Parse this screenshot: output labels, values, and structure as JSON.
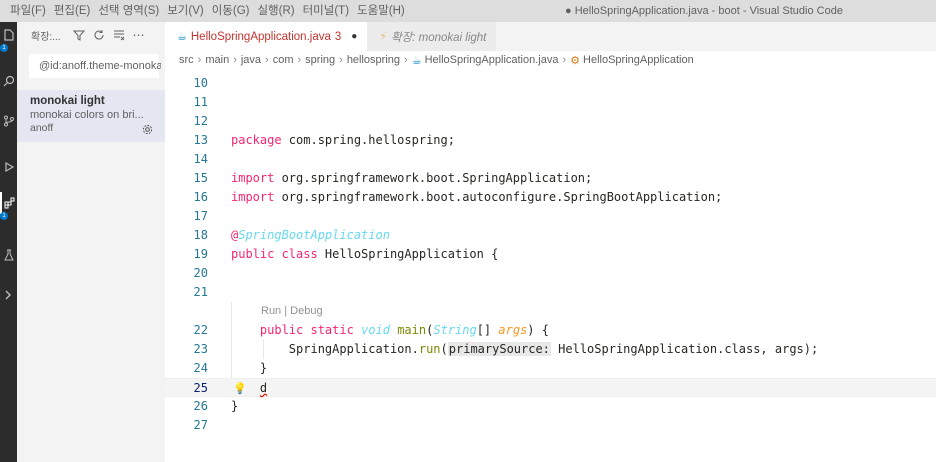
{
  "menu": {
    "items": [
      "파일(F)",
      "편집(E)",
      "선택 영역(S)",
      "보기(V)",
      "이동(G)",
      "실행(R)",
      "터미널(T)",
      "도움말(H)"
    ]
  },
  "window_title": "● HelloSpringApplication.java - boot - Visual Studio Code",
  "activity_bar": {
    "badges": [
      "1",
      "1"
    ]
  },
  "sidebar": {
    "title": "확장:...",
    "search_value": "@id:anoff.theme-monokai-light",
    "extension": {
      "name": "monokai light",
      "description": "monokai colors on bri...",
      "author": "anoff"
    }
  },
  "tabs": [
    {
      "label": "HelloSpringApplication.java",
      "problems": "3",
      "dirty": "●"
    },
    {
      "label": "확장: monokai light"
    }
  ],
  "breadcrumb": [
    "src",
    "main",
    "java",
    "com",
    "spring",
    "hellospring",
    "HelloSpringApplication.java",
    "HelloSpringApplication"
  ],
  "code": {
    "line_numbers": [
      "10",
      "11",
      "12",
      "13",
      "14",
      "15",
      "16",
      "17",
      "18",
      "19",
      "20",
      "21",
      "22",
      "23",
      "24",
      "25",
      "26",
      "27"
    ],
    "package_kw": "package",
    "package_name": " com.spring.hellospring;",
    "import_kw": "import",
    "import1": " org.springframework.boot.SpringApplication;",
    "import2": " org.springframework.boot.autoconfigure.SpringBootApplication;",
    "at": "@",
    "annotation": "SpringBootApplication",
    "class_decl_kw": "public class",
    "class_name": " HelloSpringApplication {",
    "codelens": "Run | Debug",
    "main_kw": "public static",
    "void_kw": "void",
    "main_fn": "main",
    "open_paren": "(",
    "string_type": "String",
    "brackets": "[]",
    "args_param": "args",
    "close_paren": ") {",
    "run_obj": "SpringApplication.",
    "run_fn": "run",
    "run_open": "(",
    "param_hint": "primarySource:",
    "run_args": " HelloSpringApplication.class, args);",
    "close_brace_inner": "}",
    "typed_char": "d",
    "close_brace_outer": "}"
  }
}
